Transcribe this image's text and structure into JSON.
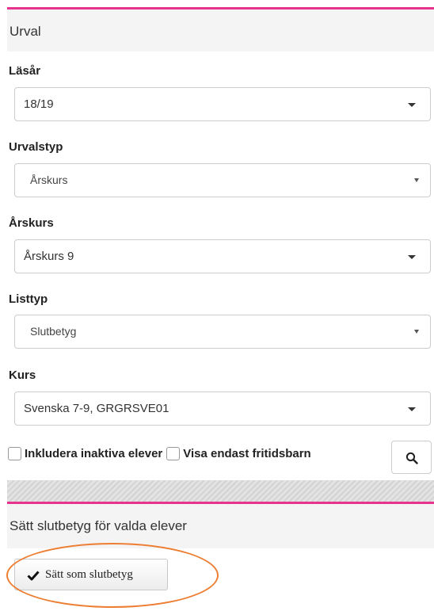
{
  "urval": {
    "title": "Urval",
    "lasar": {
      "label": "Läsår",
      "value": "18/19"
    },
    "urvalstyp": {
      "label": "Urvalstyp",
      "value": "Årskurs"
    },
    "arskurs": {
      "label": "Årskurs",
      "value": "Årskurs 9"
    },
    "listtyp": {
      "label": "Listtyp",
      "value": "Slutbetyg"
    },
    "kurs": {
      "label": "Kurs",
      "value": "Svenska 7-9, GRGRSVE01"
    },
    "include_inactive": {
      "label": "Inkludera inaktiva elever",
      "checked": false
    },
    "only_fritids": {
      "label": "Visa endast fritidsbarn",
      "checked": false
    },
    "search_icon": "magnifier-icon"
  },
  "actions": {
    "title": "Sätt slutbetyg för valda elever",
    "set_button": {
      "label": "Sätt som slutbetyg",
      "icon": "checkmark-icon"
    }
  },
  "colors": {
    "accent": "#e5338e",
    "highlight_circle": "#ed7d31",
    "panel_bg": "#f4f4f4"
  }
}
